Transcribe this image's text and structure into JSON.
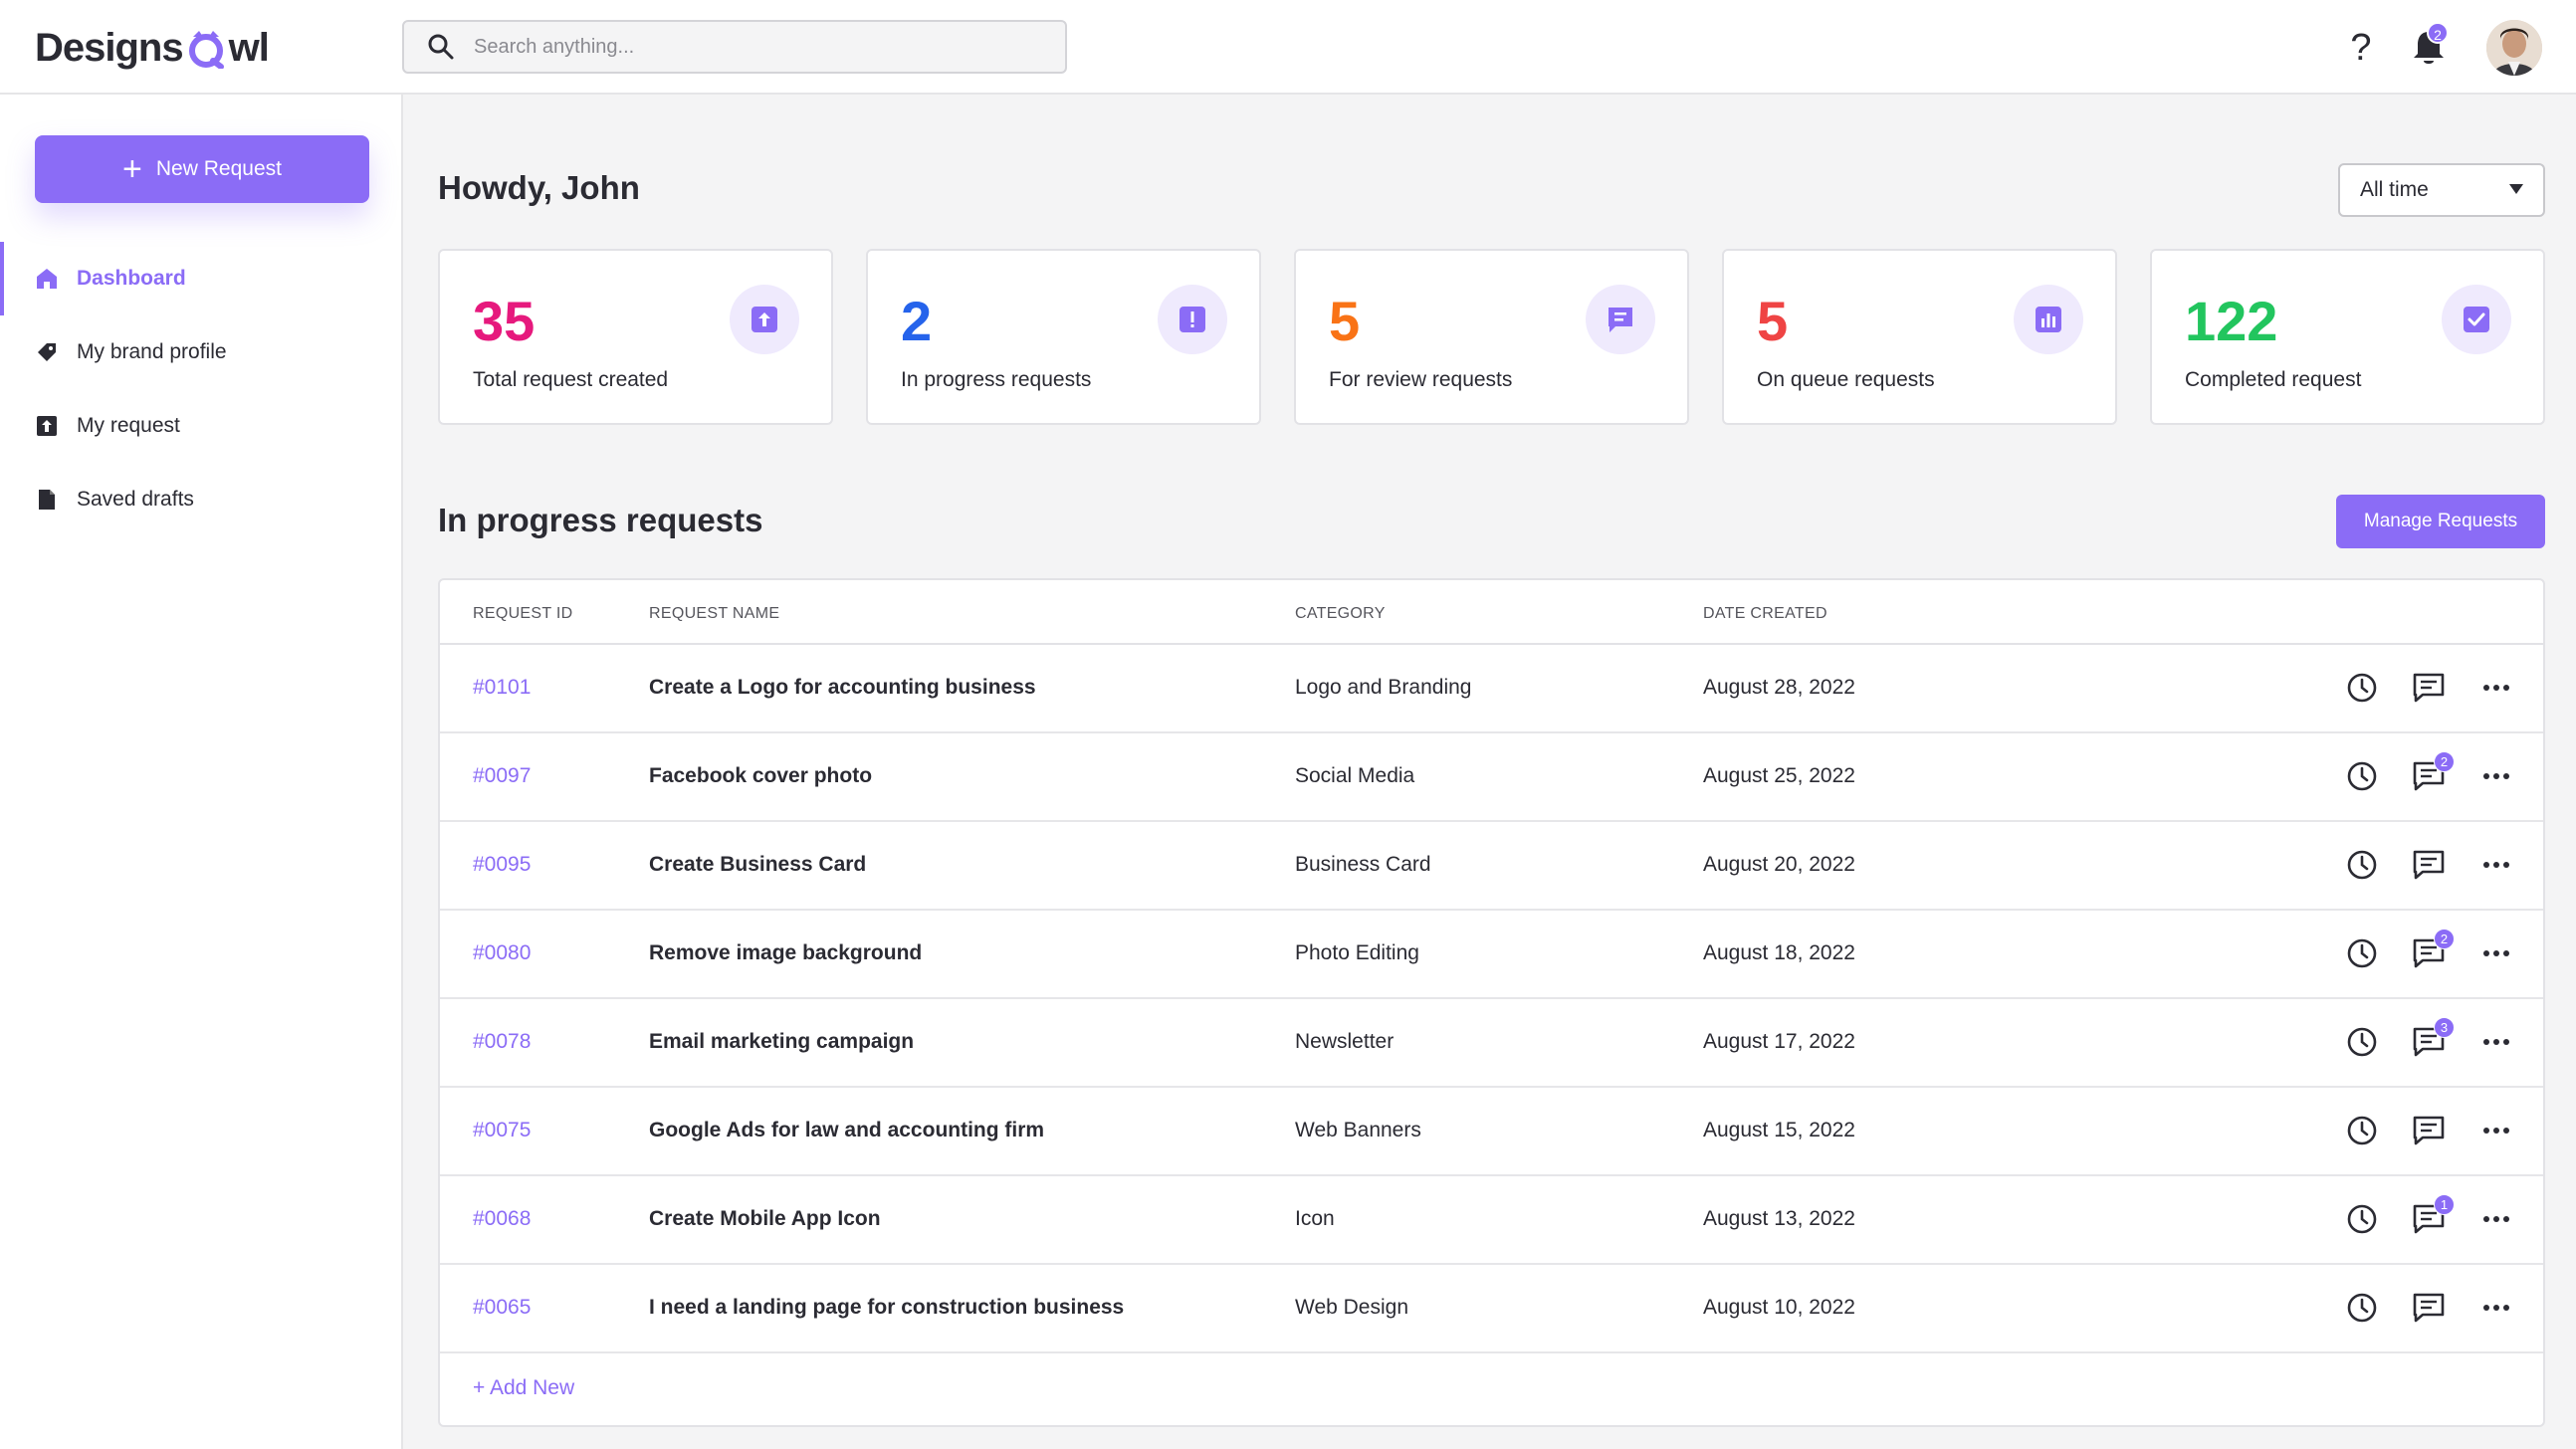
{
  "brand": {
    "name_part1": "Designs",
    "name_part2": "wl"
  },
  "search": {
    "placeholder": "Search anything..."
  },
  "header": {
    "help_label": "?",
    "notification_count": "2"
  },
  "sidebar": {
    "new_request_label": "New Request",
    "items": [
      {
        "label": "Dashboard",
        "icon": "home-icon",
        "active": true
      },
      {
        "label": "My brand profile",
        "icon": "tag-icon"
      },
      {
        "label": "My request",
        "icon": "upload-icon"
      },
      {
        "label": "Saved drafts",
        "icon": "file-icon"
      }
    ]
  },
  "greeting": "Howdy, John",
  "filter": {
    "selected": "All time"
  },
  "stats": [
    {
      "value": "35",
      "label": "Total request created",
      "color": "#e6197d",
      "icon": "upload-box-icon"
    },
    {
      "value": "2",
      "label": "In progress requests",
      "color": "#2563eb",
      "icon": "alert-icon"
    },
    {
      "value": "5",
      "label": "For review requests",
      "color": "#f97316",
      "icon": "message-icon"
    },
    {
      "value": "5",
      "label": "On queue requests",
      "color": "#ef4444",
      "icon": "chart-icon"
    },
    {
      "value": "122",
      "label": "Completed request",
      "color": "#22c55e",
      "icon": "check-icon"
    }
  ],
  "section": {
    "title": "In progress requests",
    "manage_label": "Manage Requests"
  },
  "table": {
    "headers": {
      "id": "REQUEST ID",
      "name": "REQUEST NAME",
      "category": "CATEGORY",
      "date": "DATE CREATED"
    },
    "rows": [
      {
        "id": "#0101",
        "name": "Create a Logo for accounting business",
        "category": "Logo and Branding",
        "date": "August 28, 2022",
        "comments": ""
      },
      {
        "id": "#0097",
        "name": "Facebook cover photo",
        "category": "Social Media",
        "date": "August 25, 2022",
        "comments": "2"
      },
      {
        "id": "#0095",
        "name": "Create Business Card",
        "category": "Business Card",
        "date": "August 20, 2022",
        "comments": ""
      },
      {
        "id": "#0080",
        "name": "Remove image background",
        "category": "Photo Editing",
        "date": "August 18, 2022",
        "comments": "2"
      },
      {
        "id": "#0078",
        "name": "Email marketing campaign",
        "category": "Newsletter",
        "date": "August 17, 2022",
        "comments": "3"
      },
      {
        "id": "#0075",
        "name": "Google Ads for law and accounting firm",
        "category": "Web Banners",
        "date": "August 15, 2022",
        "comments": ""
      },
      {
        "id": "#0068",
        "name": "Create Mobile App Icon",
        "category": "Icon",
        "date": "August 13, 2022",
        "comments": "1"
      },
      {
        "id": "#0065",
        "name": "I need a landing page for construction business",
        "category": "Web Design",
        "date": "August 10, 2022",
        "comments": ""
      }
    ],
    "add_new_label": "+ Add New"
  },
  "colors": {
    "accent": "#8b6cf6",
    "accent_light": "#efeafd"
  }
}
